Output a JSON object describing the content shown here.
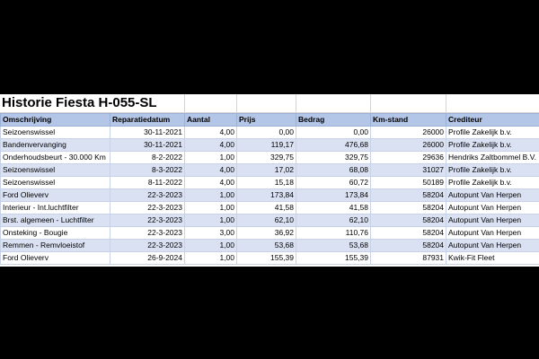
{
  "sheet": {
    "title": "Historie Fiesta H-055-SL",
    "columns": [
      "Omschrijving",
      "Reparatiedatum",
      "Aantal",
      "Prijs",
      "Bedrag",
      "Km-stand",
      "Crediteur"
    ],
    "rows": [
      [
        "Seizoenswissel",
        "30-11-2021",
        "4,00",
        "0,00",
        "0,00",
        "26000",
        "Profile Zakelijk b.v."
      ],
      [
        "Bandenvervanging",
        "30-11-2021",
        "4,00",
        "119,17",
        "476,68",
        "26000",
        "Profile Zakelijk b.v."
      ],
      [
        "Onderhoudsbeurt - 30.000 Km",
        "8-2-2022",
        "1,00",
        "329,75",
        "329,75",
        "29636",
        "Hendriks Zaltbommel B.V."
      ],
      [
        "Seizoenswissel",
        "8-3-2022",
        "4,00",
        "17,02",
        "68,08",
        "31027",
        "Profile Zakelijk b.v."
      ],
      [
        "Seizoenswissel",
        "8-11-2022",
        "4,00",
        "15,18",
        "60,72",
        "50189",
        "Profile Zakelijk b.v."
      ],
      [
        "Ford Olieverv",
        "22-3-2023",
        "1,00",
        "173,84",
        "173,84",
        "58204",
        "Autopunt Van Herpen"
      ],
      [
        "Interieur - Int.luchtfilter",
        "22-3-2023",
        "1,00",
        "41,58",
        "41,58",
        "58204",
        "Autopunt Van Herpen"
      ],
      [
        "Brst. algemeen - Luchtfilter",
        "22-3-2023",
        "1,00",
        "62,10",
        "62,10",
        "58204",
        "Autopunt Van Herpen"
      ],
      [
        "Onsteking - Bougie",
        "22-3-2023",
        "3,00",
        "36,92",
        "110,76",
        "58204",
        "Autopunt Van Herpen"
      ],
      [
        "Remmen - Remvloeistof",
        "22-3-2023",
        "1,00",
        "53,68",
        "53,68",
        "58204",
        "Autopunt Van Herpen"
      ],
      [
        "Ford Olieverv",
        "26-9-2024",
        "1,00",
        "155,39",
        "155,39",
        "87931",
        "Kwik-Fit Fleet"
      ]
    ]
  }
}
